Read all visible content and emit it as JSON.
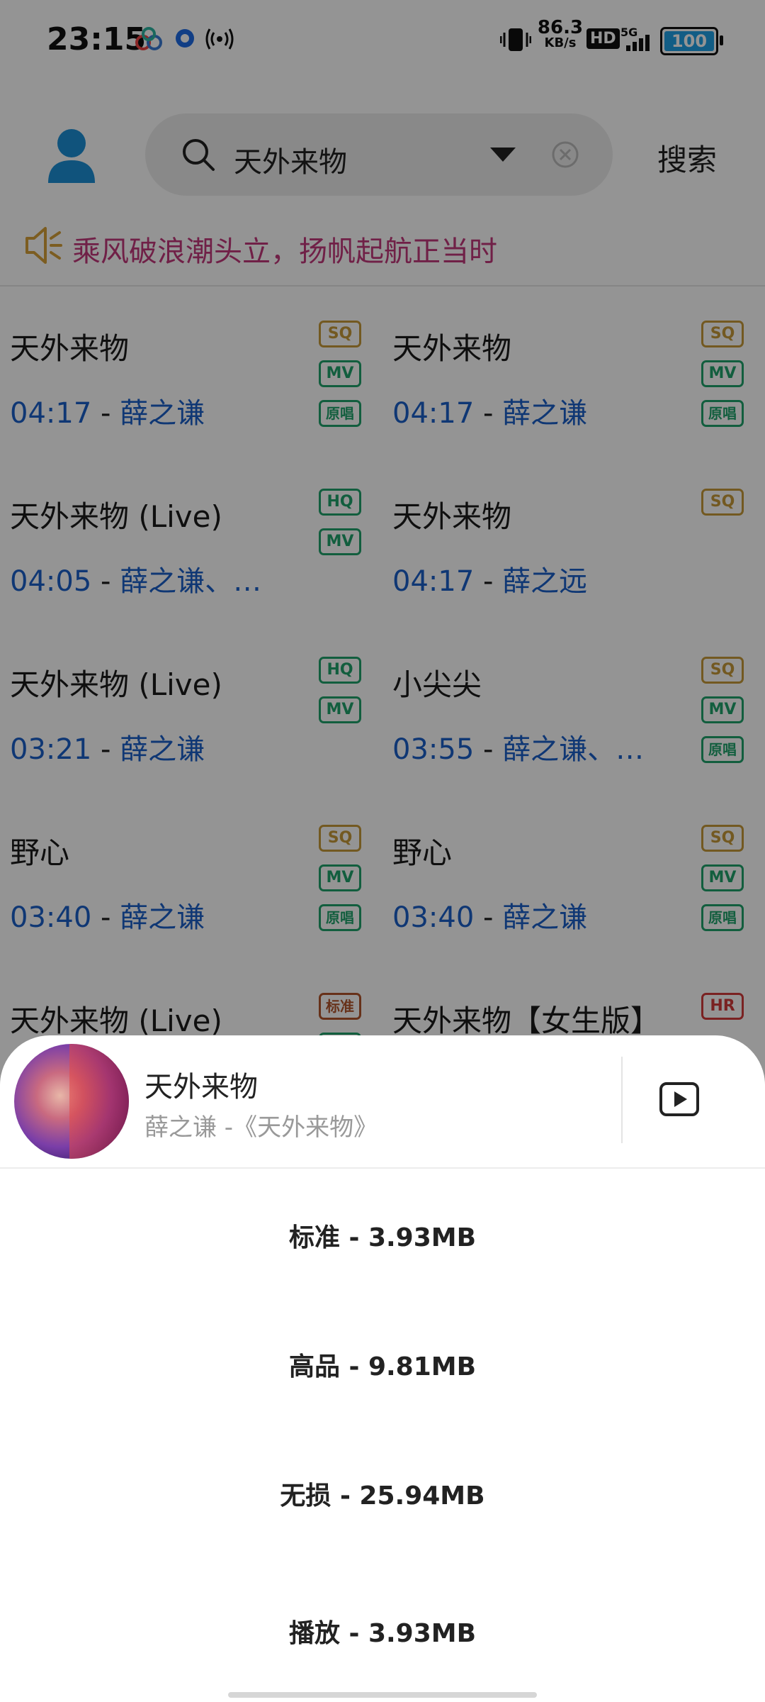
{
  "status_bar": {
    "time": "23:15",
    "net_speed_value": "86.3",
    "net_speed_unit": "KB/s",
    "hd_label": "HD",
    "network": "5G",
    "battery": "100"
  },
  "header": {
    "search_query": "天外来物",
    "search_button": "搜索"
  },
  "notice": {
    "text": "乘风破浪潮头立，扬帆起航正当时"
  },
  "songs": [
    {
      "title": "天外来物",
      "duration": "04:17",
      "sep": " - ",
      "artist": "薛之谦",
      "tags": [
        "SQ",
        "MV",
        "原唱"
      ]
    },
    {
      "title": "天外来物",
      "duration": "04:17",
      "sep": " - ",
      "artist": "薛之谦",
      "tags": [
        "SQ",
        "MV",
        "原唱"
      ]
    },
    {
      "title": "天外来物 (Live)",
      "duration": "04:05",
      "sep": " - ",
      "artist": "薛之谦、…",
      "tags": [
        "HQ",
        "MV"
      ]
    },
    {
      "title": "天外来物",
      "duration": "04:17",
      "sep": " - ",
      "artist": "薛之远",
      "tags": [
        "SQ"
      ]
    },
    {
      "title": "天外来物 (Live)",
      "duration": "03:21",
      "sep": " - ",
      "artist": "薛之谦",
      "tags": [
        "HQ",
        "MV"
      ]
    },
    {
      "title": "小尖尖",
      "duration": "03:55",
      "sep": " - ",
      "artist": "薛之谦、…",
      "tags": [
        "SQ",
        "MV",
        "原唱"
      ]
    },
    {
      "title": "野心",
      "duration": "03:40",
      "sep": " - ",
      "artist": "薛之谦",
      "tags": [
        "SQ",
        "MV",
        "原唱"
      ]
    },
    {
      "title": "野心",
      "duration": "03:40",
      "sep": " - ",
      "artist": "薛之谦",
      "tags": [
        "SQ",
        "MV",
        "原唱"
      ]
    },
    {
      "title": "天外来物 (Live)",
      "tags": [
        "标准",
        "MV"
      ]
    },
    {
      "title": "天外来物【女生版】",
      "tags": [
        "HR"
      ]
    }
  ],
  "sheet": {
    "song_title": "天外来物",
    "song_subtitle": "薛之谦 -《天外来物》",
    "options": [
      "标准 - 3.93MB",
      "高品 - 9.81MB",
      "无损 - 25.94MB",
      "播放 - 3.93MB"
    ]
  },
  "colors": {
    "accent_blue": "#1a5fc9",
    "notice_pink": "#c2377a",
    "tag_sq": "#c79a3a",
    "tag_green": "#20a36b",
    "tag_hr": "#d23b3b",
    "battery": "#1fa0e6"
  },
  "icons": [
    "signal-app-icon",
    "blue-dot-icon",
    "hotspot-icon",
    "vibrate-icon",
    "signal-bars-icon",
    "user-icon",
    "search-icon",
    "dropdown-arrow-icon",
    "clear-icon",
    "speaker-icon",
    "video-play-icon"
  ]
}
